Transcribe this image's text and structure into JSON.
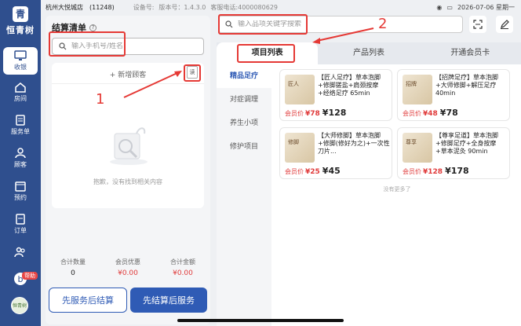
{
  "app": {
    "brand": "恒青树",
    "store": "杭州大悦城店",
    "store_id": "(11248)",
    "device_label": "设备号:",
    "version_label": "版本号：",
    "version": "1.4.3.0",
    "tel_label": "客服电话:",
    "tel": "4000080629",
    "datetime": "2026-07-06 星期一"
  },
  "sidebar": {
    "items": [
      {
        "label": "收银",
        "icon": "cashier-icon",
        "active": true
      },
      {
        "label": "房间",
        "icon": "room-icon"
      },
      {
        "label": "服务单",
        "icon": "service-order-icon"
      },
      {
        "label": "顾客",
        "icon": "customer-icon"
      },
      {
        "label": "预约",
        "icon": "calendar-icon"
      },
      {
        "label": "订单",
        "icon": "order-icon"
      },
      {
        "label": "",
        "icon": "team-icon"
      }
    ],
    "help_badge": "帮助",
    "avatar_text": "恒青树"
  },
  "checkout": {
    "title": "结算清单",
    "phone_placeholder": "输入手机号/姓名",
    "add_customer": "+ 新增顾客",
    "read_card": "读",
    "empty_text": "抱歉，没有找到相关内容",
    "totals": [
      {
        "label": "合计数量",
        "value": "0",
        "red": false
      },
      {
        "label": "会员优惠",
        "value": "¥0.00",
        "red": true
      },
      {
        "label": "合计金额",
        "value": "¥0.00",
        "red": true
      }
    ],
    "btn_service_first": "先服务后结算",
    "btn_settle_first": "先结算后服务"
  },
  "search": {
    "placeholder": "输入品项关键字搜索"
  },
  "tabs": [
    "项目列表",
    "产品列表",
    "开通会员卡"
  ],
  "categories": [
    "精品足疗",
    "对症调理",
    "养生小项",
    "修护项目"
  ],
  "products": [
    {
      "name": "【匠人足疗】草本泡脚+修脚搓盐+肩颈按摩+经络足疗 65min",
      "member_label": "会员价",
      "member_price": "¥78",
      "price": "¥128",
      "thumb": "匠人"
    },
    {
      "name": "【招牌足疗】草本泡脚+大师修脚+解压足疗 40min",
      "member_label": "会员价",
      "member_price": "¥48",
      "price": "¥78",
      "thumb": "招牌"
    },
    {
      "name": "【大师修脚】草本泡脚+修脚(修好为之)+一次性刀片...",
      "member_label": "会员价",
      "member_price": "¥25",
      "price": "¥45",
      "thumb": "修脚"
    },
    {
      "name": "【尊享足道】草本泡脚+修脚足疗+全身按摩+草本泥灸 90min",
      "member_label": "会员价",
      "member_price": "¥128",
      "price": "¥178",
      "thumb": "尊享"
    }
  ],
  "more_text": "没有更多了",
  "annotations": [
    "1",
    "2"
  ],
  "colors": {
    "primary": "#2f5bb5",
    "sidebar": "#2f4f8e",
    "price_red": "#e03a3a",
    "annotation": "#e53935"
  }
}
